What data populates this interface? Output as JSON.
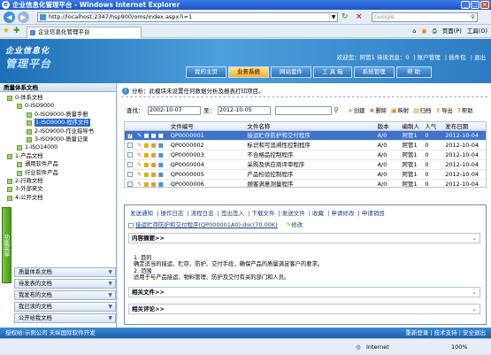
{
  "window": {
    "title": "企业信息化管理平台 - Windows Internet Explorer"
  },
  "browser": {
    "address": "http://localhost:2347/hsp900/oms/index.aspx?i=1",
    "search_placeholder": "Google",
    "tab_title": "企业信息化管理平台",
    "tools": [
      "页面(P)",
      "工具(O)"
    ]
  },
  "banner": {
    "logo_line1": "企业信息化",
    "logo_line2": "管理平台",
    "welcome": "欢迎您：阿管1 待读消息：",
    "unread": "0",
    "links": [
      "| 账户管理",
      "| 插件包",
      "| 退出"
    ],
    "nav": [
      "我的主页",
      "业务系统",
      "网站套件",
      "工 具 箱",
      "系统管理",
      "帮    助"
    ]
  },
  "sidebar": {
    "header": "质量体系文档",
    "vtab": "功能菜单",
    "tree": [
      {
        "label": "0-体系文档",
        "indent": 0
      },
      {
        "label": "0-ISO9000",
        "indent": 1
      },
      {
        "label": "0-ISO9000-质量手册",
        "indent": 2
      },
      {
        "label": "1-ISO9000-程序文件",
        "indent": 2,
        "selected": true
      },
      {
        "label": "2-ISO9000-作业指导书",
        "indent": 2
      },
      {
        "label": "3-ISO9000-质量记录",
        "indent": 2
      },
      {
        "label": "1-ISO14000",
        "indent": 1
      },
      {
        "label": "1-产品文档",
        "indent": 0
      },
      {
        "label": "通用软件产品",
        "indent": 1
      },
      {
        "label": "行业软件产品",
        "indent": 1
      },
      {
        "label": "2-行政文档",
        "indent": 0
      },
      {
        "label": "3-外部来文",
        "indent": 0
      },
      {
        "label": "4-公开文档",
        "indent": 0
      }
    ],
    "menus": [
      "质量体系文档",
      "待发表的文档",
      "我发布的文档",
      "我已读的文档",
      "公开给我文档"
    ]
  },
  "main": {
    "info": "分析：此模块未设置任何数据分析及报表打印项目。",
    "query": {
      "label": "查找：",
      "from": "2002-10-07",
      "to_label": "至：",
      "to": "2012-10-05"
    },
    "tools": [
      "创建",
      "删除",
      "映射",
      "归档",
      "导出",
      "帮助"
    ],
    "headers": [
      "",
      "",
      "文件编号",
      "文件名称",
      "版本",
      "编制人",
      "人气",
      "发布日期"
    ],
    "rows": [
      {
        "no": "QP0000001",
        "name": "接运贮存防护和交付程序",
        "ver": "A/0",
        "author": "阿管1",
        "pop": "0",
        "date": "2012-10-04",
        "selected": true
      },
      {
        "no": "QP0000002",
        "name": "标识和可追溯性控制程序",
        "ver": "A/0",
        "author": "阿管1",
        "pop": "0",
        "date": "2012-10-04"
      },
      {
        "no": "QP0000003",
        "name": "不合格品控制程序",
        "ver": "A/0",
        "author": "阿管1",
        "pop": "0",
        "date": "2012-10-04"
      },
      {
        "no": "QP0000004",
        "name": "采购及供应商评审程序",
        "ver": "A/0",
        "author": "阿管1",
        "pop": "0",
        "date": "2012-10-04"
      },
      {
        "no": "QP0000005",
        "name": "产品检验控制程序",
        "ver": "A/0",
        "author": "阿管1",
        "pop": "0",
        "date": "2012-10-04"
      },
      {
        "no": "QP0000006",
        "name": "顾客满意测量程序",
        "ver": "A/0",
        "author": "阿管1",
        "pop": "0",
        "date": "2012-10-04"
      }
    ],
    "detail": {
      "tabs": [
        "发送通知",
        "| 操作日志",
        "| 流程日志",
        "| 签出签入",
        "| 下载文件",
        "| 发送文件",
        "| 收藏",
        "| 申请修改",
        "| 申请销毁"
      ],
      "file": "接运贮存防护和交付程序(QP000001A0).doc(70.00K)",
      "edit": "修改",
      "summary_title": "内容摘要>>",
      "content": [
        "1. 目的",
        "确定适当的接运、贮存、防护、交付手段，确保产品的质量满足客户的要求。",
        "2. 范围",
        "适用于与产品接运、物料管理、防护及交付有关的部门和人员。"
      ],
      "related_files": "相关文件>>",
      "related_comments": "相关评论>>"
    }
  },
  "footer": {
    "left": "授权给:示例公司  天纵国际软件开发",
    "right": [
      "重新登录",
      "| 技术支持",
      "| 安全退出"
    ]
  },
  "status": {
    "zone": "Internet",
    "zoom": "100%"
  }
}
